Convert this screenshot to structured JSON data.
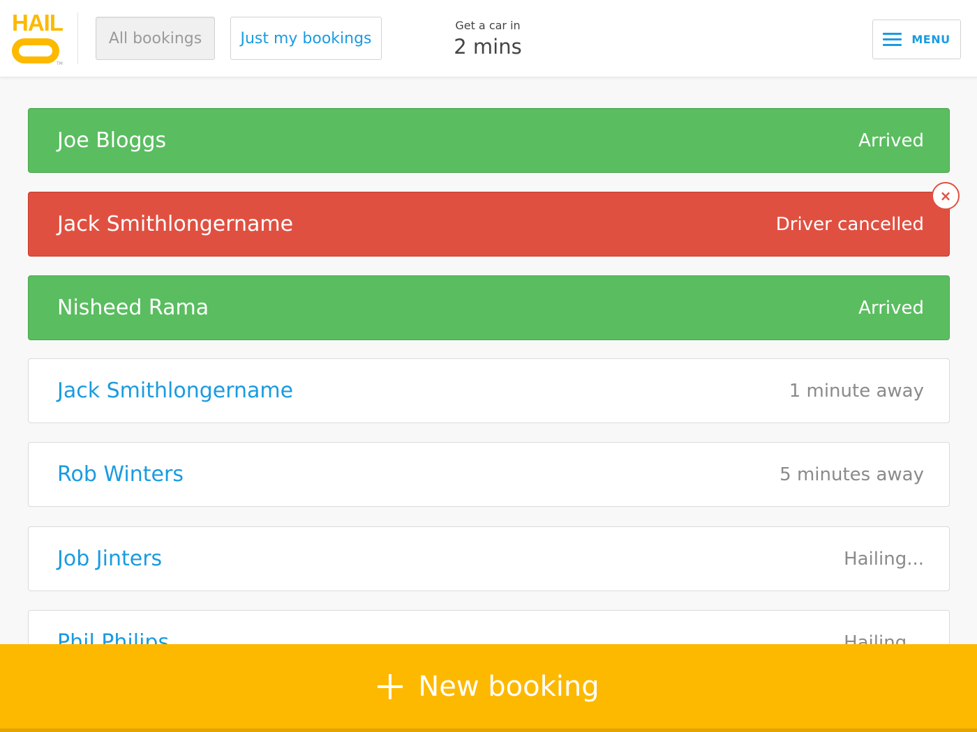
{
  "colors": {
    "brand_yellow": "#fdb900",
    "link_blue": "#1a9be0",
    "arrived_green": "#5abd60",
    "cancelled_red": "#e05041"
  },
  "logo": {
    "text": "HAIL",
    "tm": "TM"
  },
  "tabs": {
    "all": "All bookings",
    "mine": "Just my bookings"
  },
  "eta": {
    "label": "Get a car in",
    "value": "2 mins"
  },
  "menu": {
    "label": "MENU",
    "icon": "hamburger-icon"
  },
  "bookings": [
    {
      "name": "Joe Bloggs",
      "status": "Arrived",
      "state": "arrived"
    },
    {
      "name": "Jack Smithlongername",
      "status": "Driver cancelled",
      "state": "cancelled"
    },
    {
      "name": "Nisheed Rama",
      "status": "Arrived",
      "state": "arrived"
    },
    {
      "name": "Jack Smithlongername",
      "status": "1 minute away",
      "state": "pending"
    },
    {
      "name": "Rob Winters",
      "status": "5 minutes away",
      "state": "pending"
    },
    {
      "name": "Job Jinters",
      "status": "Hailing...",
      "state": "pending"
    },
    {
      "name": "Phil Philips",
      "status": "Hailing...",
      "state": "pending"
    }
  ],
  "dismiss": {
    "icon": "close-icon",
    "glyph": "×"
  },
  "new_booking": {
    "label": "New booking",
    "icon": "plus-icon"
  }
}
